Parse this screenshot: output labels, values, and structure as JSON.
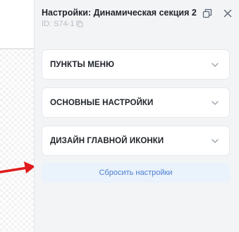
{
  "panel": {
    "title": "Настройки: Динамическая секция 2",
    "id_label": "ID: S74-1",
    "icons": {
      "detach": "detach-window-icon",
      "close": "close-icon",
      "copy": "copy-icon"
    }
  },
  "sections": [
    {
      "label": "ПУНКТЫ МЕНЮ",
      "icon": "chevron-down-icon"
    },
    {
      "label": "ОСНОВНЫЕ НАСТРОЙКИ",
      "icon": "chevron-down-icon"
    },
    {
      "label": "ДИЗАЙН ГЛАВНОЙ ИКОНКИ",
      "icon": "chevron-down-icon"
    }
  ],
  "reset_button": {
    "label": "Сбросить настройки"
  },
  "colors": {
    "accent": "#4a7fcf",
    "reset_bg": "#eaf2fc",
    "panel_bg": "#f3f4f6",
    "arrow": "#e01b1b"
  }
}
